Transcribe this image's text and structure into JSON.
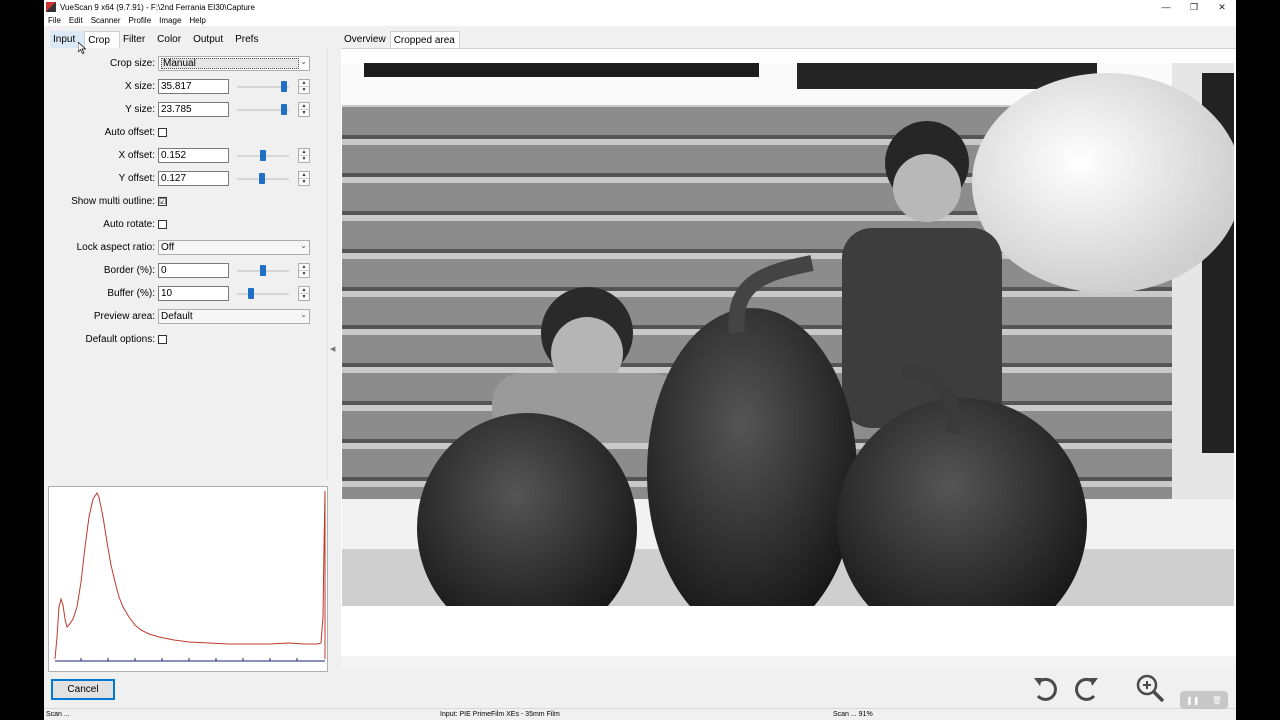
{
  "window": {
    "title": "VueScan 9 x64 (9.7.91) - F:\\2nd Ferrania EI30\\Capture",
    "controls": [
      "—",
      "❐",
      "✕"
    ]
  },
  "menu": [
    "File",
    "Edit",
    "Scanner",
    "Profile",
    "Image",
    "Help"
  ],
  "left_tabs": [
    "Input",
    "Crop",
    "Filter",
    "Color",
    "Output",
    "Prefs"
  ],
  "active_left_tab": "Crop",
  "crop": {
    "crop_size": {
      "label": "Crop size:",
      "value": "Manual"
    },
    "x_size": {
      "label": "X size:",
      "value": "35.817",
      "level": 0.95
    },
    "y_size": {
      "label": "Y size:",
      "value": "23.785",
      "level": 0.95
    },
    "auto_offset": {
      "label": "Auto offset:",
      "checked": false
    },
    "x_offset": {
      "label": "X offset:",
      "value": "0.152",
      "level": 0.5
    },
    "y_offset": {
      "label": "Y offset:",
      "value": "0.127",
      "level": 0.48
    },
    "show_multi_outline": {
      "label": "Show multi outline:",
      "checked": true,
      "mark": "☑"
    },
    "auto_rotate": {
      "label": "Auto rotate:",
      "checked": false
    },
    "lock_aspect_ratio": {
      "label": "Lock aspect ratio:",
      "value": "Off"
    },
    "border": {
      "label": "Border (%):",
      "value": "0",
      "level": 0.5
    },
    "buffer": {
      "label": "Buffer (%):",
      "value": "10",
      "level": 0.24
    },
    "preview_area": {
      "label": "Preview area:",
      "value": "Default"
    },
    "default_options": {
      "label": "Default options:",
      "checked": false
    }
  },
  "cancel_label": "Cancel",
  "viewer_tabs": [
    "Overview",
    "Cropped area"
  ],
  "active_viewer_tab": "Cropped area",
  "status": {
    "left": "Scan ...",
    "center": "Input: PIE PrimeFilm XEs - 35mm Film",
    "right": "Scan ... 91%"
  },
  "colors": {
    "accent": "#0078d7",
    "slider_thumb": "#1f6fc6",
    "histogram_line": "#c0392b",
    "histogram_axis": "#1a237e"
  },
  "icons": [
    "rotate-left-icon",
    "rotate-right-icon",
    "zoom-in-icon",
    "pause-icon",
    "trash-icon"
  ]
}
